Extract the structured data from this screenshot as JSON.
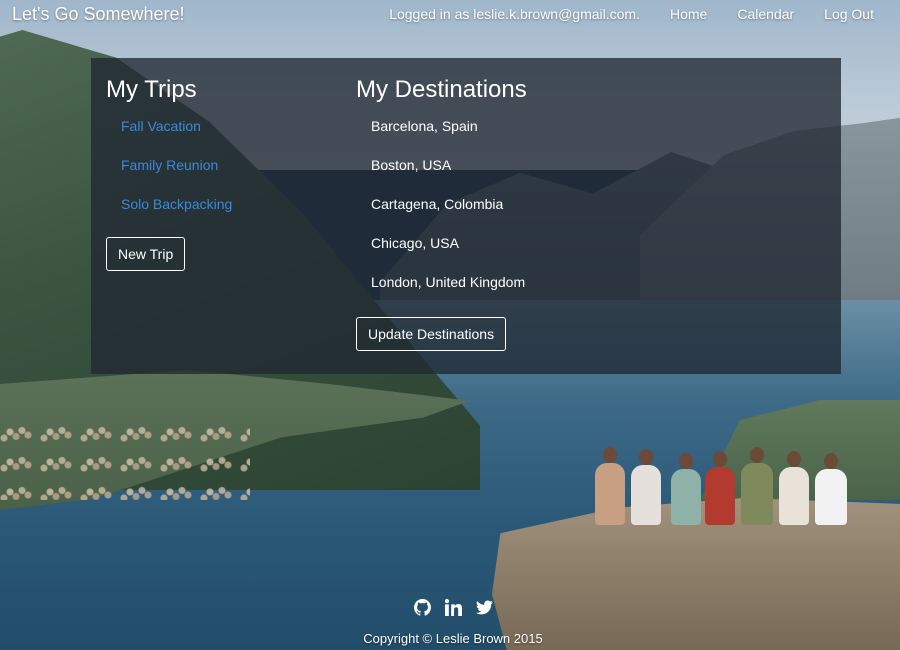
{
  "header": {
    "brand": "Let's Go Somewhere!",
    "logged_in_text": "Logged in as leslie.k.brown@gmail.com.",
    "nav": {
      "home": "Home",
      "calendar": "Calendar",
      "logout": "Log Out"
    }
  },
  "trips": {
    "title": "My Trips",
    "items": [
      "Fall Vacation",
      "Family Reunion",
      "Solo Backpacking"
    ],
    "new_trip_label": "New Trip"
  },
  "destinations": {
    "title": "My Destinations",
    "items": [
      "Barcelona, Spain",
      "Boston, USA",
      "Cartagena, Colombia",
      "Chicago, USA",
      "London, United Kingdom"
    ],
    "update_label": "Update Destinations"
  },
  "footer": {
    "icons": [
      "github-icon",
      "linkedin-icon",
      "twitter-icon"
    ],
    "copyright": "Copyright © Leslie Brown 2015"
  },
  "colors": {
    "link": "#3b8ad9",
    "panel": "#202832"
  }
}
